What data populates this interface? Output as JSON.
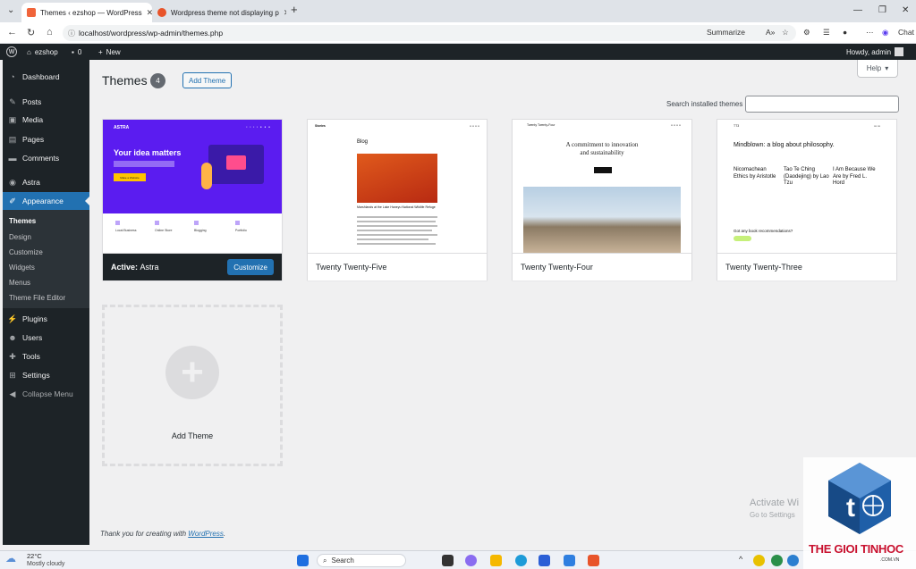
{
  "browser": {
    "tabs": [
      {
        "title": "Themes ‹ ezshop — WordPress",
        "active": true
      },
      {
        "title": "Wordpress theme not displaying p",
        "active": false
      }
    ],
    "url": "localhost/wordpress/wp-admin/themes.php",
    "summarize": "Summarize",
    "chat": "Chat"
  },
  "adminbar": {
    "site_name": "ezshop",
    "comments_count": "0",
    "new_label": "New",
    "howdy": "Howdy, admin"
  },
  "sidebar": {
    "items": [
      {
        "label": "Dashboard",
        "icon": "dashboard-icon"
      },
      {
        "label": "Posts",
        "icon": "pin-icon"
      },
      {
        "label": "Media",
        "icon": "media-icon"
      },
      {
        "label": "Pages",
        "icon": "page-icon"
      },
      {
        "label": "Comments",
        "icon": "comment-icon"
      },
      {
        "label": "Astra",
        "icon": "astra-icon"
      },
      {
        "label": "Appearance",
        "icon": "brush-icon"
      },
      {
        "label": "Plugins",
        "icon": "plug-icon"
      },
      {
        "label": "Users",
        "icon": "user-icon"
      },
      {
        "label": "Tools",
        "icon": "wrench-icon"
      },
      {
        "label": "Settings",
        "icon": "settings-icon"
      },
      {
        "label": "Collapse Menu",
        "icon": "collapse-icon"
      }
    ],
    "submenu": [
      "Themes",
      "Design",
      "Customize",
      "Widgets",
      "Menus",
      "Theme File Editor"
    ]
  },
  "main": {
    "title": "Themes",
    "count": "4",
    "add_theme_button": "Add Theme",
    "help": "Help",
    "search_label": "Search installed themes",
    "themes": [
      {
        "name": "Astra",
        "active_prefix": "Active:",
        "customize": "Customize"
      },
      {
        "name": "Twenty Twenty-Five"
      },
      {
        "name": "Twenty Twenty-Four"
      },
      {
        "name": "Twenty Twenty-Three"
      }
    ],
    "add_new_label": "Add Theme",
    "footer_prefix": "Thank you for creating with",
    "footer_link": "WordPress",
    "footer_suffix": "."
  },
  "previews": {
    "astra": {
      "logo": "ASTRA",
      "heading": "Your idea matters",
      "cta": "Make a Website",
      "features": [
        "Local Business",
        "Online Store",
        "Blogging",
        "Portfolio"
      ]
    },
    "tt5": {
      "brand": "Stories",
      "heading": "Blog",
      "caption": "Marshlands at the Lake Haneyu National Wildlife Refuge"
    },
    "tt4": {
      "brand": "Twenty Twenty-Four",
      "heading": "A commitment to innovation and sustainability"
    },
    "tt3": {
      "brand": "TT3",
      "heading": "Mindblown: a blog about philosophy.",
      "posts": [
        "Nicomachean Ethics by Aristotle",
        "Tao Te Ching (Daodejing) by Lao Tzu",
        "I Am Because We Are by Fred L. Hord"
      ],
      "question": "Got any book recommendations?"
    }
  },
  "windows": {
    "activate": "Activate Wi",
    "activate_sub": "Go to Settings"
  },
  "taskbar": {
    "weather_temp": "22°C",
    "weather_desc": "Mostly cloudy",
    "search": "Search"
  },
  "watermark": {
    "brand": "THE GIOI TINHOC",
    "domain": ".COM.VN"
  },
  "colors": {
    "wp_blue": "#2271b1",
    "admin_dark": "#1d2327",
    "astra_purple": "#5b1cf0"
  }
}
